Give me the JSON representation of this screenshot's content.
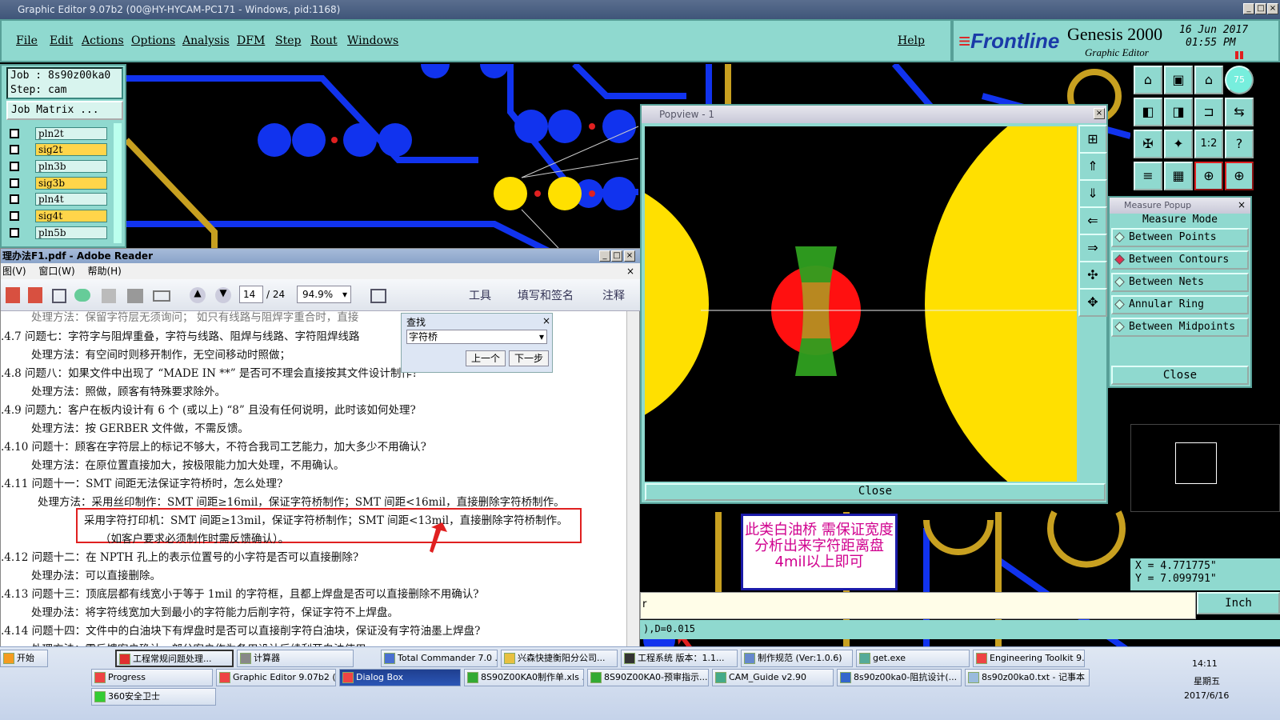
{
  "window_title": "Graphic Editor 9.07b2 (00@HY-HYCAM-PC171 - Windows, pid:1168)",
  "menu": [
    "File",
    "Edit",
    "Actions",
    "Options",
    "Analysis",
    "DFM",
    "Step",
    "Rout",
    "Windows"
  ],
  "help": "Help",
  "brand": {
    "logo": "Frontline",
    "product": "Genesis 2000",
    "sub": "Graphic Editor",
    "date": "16 Jun 2017",
    "time": "01:55 PM",
    "badge": "75"
  },
  "job": {
    "job_label": "Job  : 8s90z00ka0",
    "step_label": "Step: cam",
    "matrix": "Job Matrix ..."
  },
  "layers": [
    "pln2t",
    "sig2t",
    "pln3b",
    "sig3b",
    "pln4t",
    "sig4t",
    "pln5b"
  ],
  "colors": {
    "sig": "#ffd54a",
    "pln": "#d8f4ee",
    "panel": "#8fd9cf",
    "blue": "#1133ee",
    "gold": "#c8a020",
    "pad": "#ffe000",
    "red": "#ff1010",
    "green": "#2fa020"
  },
  "acrobat": {
    "title": "理办法F1.pdf - Adobe Reader",
    "menu": [
      "图(V)",
      "窗口(W)",
      "帮助(H)"
    ],
    "page": "14",
    "pages": "/ 24",
    "zoom": "94.9%",
    "tools": [
      "工具",
      "填写和签名",
      "注释"
    ],
    "find": {
      "title": "查找",
      "value": "字符桥",
      "prev": "上一个",
      "next": "下一步"
    },
    "lines": [
      "处理方法：保留字符层无须询问；  如只有线路与阻焊字重合时，直接",
      ".4.7  问题七：字符字与阻焊重叠，字符与线路、阻焊与线路、字符阻焊线路",
      "处理方法：有空间时则移开制作，无空间移动时照做；",
      ".4.8  问题八：如果文件中出现了 “MADE IN **” 是否可不理会直接按其文件设计制作?",
      "处理方法：照做，顾客有特殊要求除外。",
      ".4.9  问题九：客户在板内设计有 6 个 (或以上) “8” 且没有任何说明，此时该如何处理?",
      "处理方法：按 GERBER 文件做，不需反馈。",
      ".4.10  问题十：顾客在字符层上的标记不够大，不符合我司工艺能力，加大多少不用确认?",
      "处理方法：在原位置直接加大，按极限能力加大处理，不用确认。",
      ".4.11  问题十一：SMT 间距无法保证字符桥时，怎么处理?",
      "处理方法：采用丝印制作：SMT 间距≥16mil，保证字符桥制作；SMT 间距<16mil，直接删除字符桥制作。",
      "采用字符打印机：SMT 间距≥13mil，保证字符桥制作；SMT 间距<13mil，直接删除字符桥制作。",
      "（如客户要求必须制作时需反馈确认）。",
      ".4.12  问题十二：在 NPTH 孔上的表示位置号的小字符是否可以直接删除?",
      "处理办法：可以直接删除。",
      ".4.13  问题十三：顶底层都有线宽小于等于 1mil 的字符框，且都上焊盘是否可以直接删除不用确认?",
      "处理办法：将字符线宽加大到最小的字符能力后削字符，保证字符不上焊盘。",
      ".4.14  问题十四：文件中的白油块下有焊盘时是否可以直接削字符白油块，保证没有字符油墨上焊盘?",
      "处理方法：需反馈客户确认，部分客户作为备用设计后续刮开白油使用。"
    ]
  },
  "popview": {
    "title": "Popview - 1",
    "close": "Close"
  },
  "measure": {
    "title": "Measure Popup",
    "mode": "Measure Mode",
    "options": [
      "Between Points",
      "Between Contours",
      "Between Nets",
      "Annular Ring",
      "Between Midpoints"
    ],
    "selected": 1,
    "close": "Close"
  },
  "coords": {
    "x": "X  =  4.771775\"",
    "y": "Y  =  7.099791\""
  },
  "annotation": "此类白油桥  需保证宽度   分析出来字符距离盘4mil以上即可",
  "command": "r",
  "unit": "Inch",
  "status": "),D=0.015",
  "taskbar": {
    "start": "开始",
    "row1": [
      "工程常规问题处理...",
      "计算器",
      "Total Commander 7.0 ...",
      "兴森快捷衡阳分公司...",
      "工程系统   版本：1.1...",
      "制作规范 (Ver:1.0.6)",
      "get.exe",
      "Engineering Toolkit 9...."
    ],
    "row2": [
      "Progress",
      "Graphic Editor 9.07b2 (0...",
      "Dialog Box",
      "8S90Z00KA0制作单.xls ...",
      "8S90Z00KA0-预审指示...",
      "CAM_Guide v2.90",
      "8s90z00ka0-阻抗设计(...",
      "8s90z00ka0.txt - 记事本"
    ],
    "row3": [
      "360安全卫士"
    ],
    "clock": "14:11",
    "weekday": "星期五",
    "date": "2017/6/16"
  }
}
